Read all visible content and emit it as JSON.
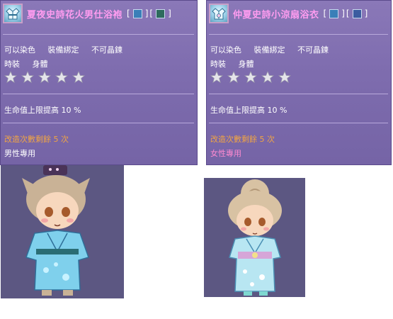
{
  "left_item": {
    "name": "夏夜史詩花火男仕浴袍",
    "bracket_open": "[",
    "bracket_close": "]",
    "slot_colors": [
      "#3a7fb8",
      "#2e6b5e"
    ],
    "flags": [
      "可以染色",
      "裝備綁定",
      "不可晶鍊"
    ],
    "category": "時裝",
    "part": "身體",
    "stars": 5,
    "stat": "生命值上限提高 10 %",
    "remodel": "改造次數剩餘 5 次",
    "restriction": "男性專用",
    "icon": "kimono-icon"
  },
  "right_item": {
    "name": "仲夏史詩小涼扇浴衣",
    "bracket_open": "[",
    "bracket_close": "]",
    "slot_colors": [
      "#3a7fb8",
      "#3b5ca0"
    ],
    "flags": [
      "可以染色",
      "裝備綁定",
      "不可晶鍊"
    ],
    "category": "時裝",
    "part": "身體",
    "stars": 5,
    "stat": "生命值上限提高 10 %",
    "remodel": "改造次數剩餘 5 次",
    "restriction": "女性專用",
    "icon": "kimono-icon"
  },
  "colors": {
    "panel_bg": "#7e6cae",
    "item_name": "#ff9cf0",
    "remodel_text": "#f0a444",
    "female_text": "#ff8ad0",
    "preview_bg": "#5c5782"
  }
}
